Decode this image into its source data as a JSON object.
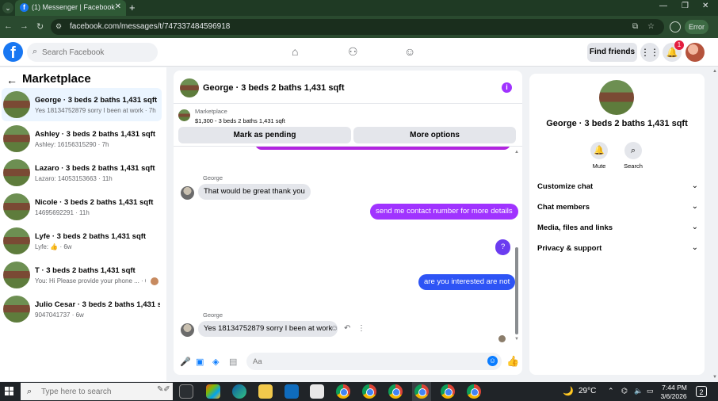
{
  "browser": {
    "tab_title": "(1) Messenger | Facebook",
    "url": "facebook.com/messages/t/747337484596918",
    "error_label": "Error"
  },
  "fb_nav": {
    "search_placeholder": "Search Facebook",
    "find_friends": "Find friends",
    "notification_count": "1"
  },
  "sidebar": {
    "title": "Marketplace",
    "conversations": [
      {
        "title": "George · 3 beds 2 baths 1,431 sqft",
        "subtitle": "Yes 18134752879 sorry I been at work · 7h"
      },
      {
        "title": "Ashley · 3 beds 2 baths 1,431 sqft",
        "subtitle": "Ashley: 16156315290 · 7h"
      },
      {
        "title": "Lazaro · 3 beds 2 baths 1,431 sqft",
        "subtitle": "Lazaro: 14053153663 · 11h"
      },
      {
        "title": "Nicole · 3 beds 2 baths 1,431 sqft",
        "subtitle": "14695692291 · 11h"
      },
      {
        "title": "Lyfe · 3 beds 2 baths 1,431 sqft",
        "subtitle": "Lyfe: 👍 · 6w"
      },
      {
        "title": "T · 3 beds 2 baths 1,431 sqft",
        "subtitle": "You: Hi Please provide your phone ... · 6w"
      },
      {
        "title": "Julio Cesar · 3 beds 2 baths 1,431 s...",
        "subtitle": "9047041737 · 6w"
      }
    ]
  },
  "chat": {
    "title": "George · 3 beds 2 baths 1,431 sqft",
    "listing_category": "Marketplace",
    "listing_price": "$1,300 - 3 beds 2 baths 1,431 sqft",
    "mark_pending": "Mark as pending",
    "more_options": "More options",
    "messages": [
      {
        "sender": "George",
        "text": "That would be great thank you"
      },
      {
        "text": "send me contact number for more details"
      },
      {
        "text": "?"
      },
      {
        "text": "are you interested are not"
      },
      {
        "sender": "George",
        "text": "Yes 18134752879 sorry I been at work"
      }
    ],
    "composer_placeholder": "Aa"
  },
  "details": {
    "title": "George · 3 beds 2 baths 1,431 sqft",
    "mute_label": "Mute",
    "search_label": "Search",
    "rows": [
      "Customize chat",
      "Chat members",
      "Media, files and links",
      "Privacy & support"
    ]
  },
  "taskbar": {
    "search_placeholder": "Type here to search",
    "temperature": "29°C",
    "time": "7:44 PM",
    "date": "3/6/2026",
    "notification_count": "2"
  },
  "colors": {
    "fb_blue": "#1877f2",
    "purple_bubble": "#a033ff",
    "blue_bubble": "#0a7cff"
  }
}
